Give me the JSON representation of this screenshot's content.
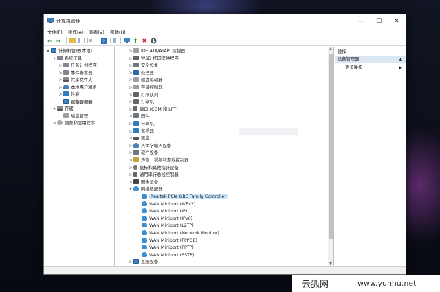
{
  "window": {
    "title": "计算机管理"
  },
  "menu": [
    "文件(F)",
    "操作(A)",
    "查看(V)",
    "帮助(H)"
  ],
  "toolbar_icons": [
    "back-arrow-icon",
    "forward-arrow-icon",
    "folder-up-icon",
    "console-tree-icon",
    "properties-icon",
    "help-icon",
    "view-icon",
    "monitor-icon",
    "enable-device-icon",
    "uninstall-device-icon",
    "update-driver-icon"
  ],
  "tree": [
    {
      "label": "计算机管理(本地)",
      "exp": "▾",
      "indent": 0,
      "icon": "pc"
    },
    {
      "label": "系统工具",
      "exp": "▾",
      "indent": 1,
      "icon": "tool"
    },
    {
      "label": "任务计划程序",
      "exp": ">",
      "indent": 2,
      "icon": "tool"
    },
    {
      "label": "事件查看器",
      "exp": ">",
      "indent": 2,
      "icon": "tool"
    },
    {
      "label": "共享文件夹",
      "exp": ">",
      "indent": 2,
      "icon": "store"
    },
    {
      "label": "本地用户和组",
      "exp": ">",
      "indent": 2,
      "icon": "person"
    },
    {
      "label": "性能",
      "exp": ">",
      "indent": 2,
      "icon": "mon"
    },
    {
      "label": "设备管理器",
      "exp": "",
      "indent": 2,
      "icon": "pc",
      "selected": true
    },
    {
      "label": "存储",
      "exp": "▾",
      "indent": 1,
      "icon": "store"
    },
    {
      "label": "磁盘管理",
      "exp": "",
      "indent": 2,
      "icon": "disk"
    },
    {
      "label": "服务和应用程序",
      "exp": ">",
      "indent": 1,
      "icon": "gear"
    }
  ],
  "devices": [
    {
      "label": "IDE ATA/ATAPI 控制器",
      "exp": ">",
      "icon": "disk"
    },
    {
      "label": "WSD 打印提供程序",
      "exp": ">",
      "icon": "printer"
    },
    {
      "label": "安全设备",
      "exp": ">",
      "icon": "dev"
    },
    {
      "label": "处理器",
      "exp": ">",
      "icon": "cpu"
    },
    {
      "label": "磁盘驱动器",
      "exp": ">",
      "icon": "disk"
    },
    {
      "label": "存储控制器",
      "exp": ">",
      "icon": "disk"
    },
    {
      "label": "打印队列",
      "exp": ">",
      "icon": "printer"
    },
    {
      "label": "打印机",
      "exp": ">",
      "icon": "printer"
    },
    {
      "label": "端口 (COM 和 LPT)",
      "exp": ">",
      "icon": "usb"
    },
    {
      "label": "固件",
      "exp": ">",
      "icon": "dev"
    },
    {
      "label": "计算机",
      "exp": ">",
      "icon": "mon"
    },
    {
      "label": "监视器",
      "exp": ">",
      "icon": "mon"
    },
    {
      "label": "键盘",
      "exp": ">",
      "icon": "keyb"
    },
    {
      "label": "人体学输入设备",
      "exp": ">",
      "icon": "person"
    },
    {
      "label": "软件设备",
      "exp": ">",
      "icon": "dev"
    },
    {
      "label": "声音、视频和游戏控制器",
      "exp": ">",
      "icon": "sound"
    },
    {
      "label": "鼠标和其他指针设备",
      "exp": ">",
      "icon": "mouse"
    },
    {
      "label": "通用串行总线控制器",
      "exp": ">",
      "icon": "usb"
    },
    {
      "label": "图像设备",
      "exp": ">",
      "icon": "cam"
    },
    {
      "label": "网络适配器",
      "exp": "▾",
      "icon": "net"
    },
    {
      "label": "Realtek PCIe GBE Family Controller",
      "exp": "",
      "icon": "net",
      "child": true,
      "selected": true
    },
    {
      "label": "WAN Miniport (IKEv2)",
      "exp": "",
      "icon": "net",
      "child": true
    },
    {
      "label": "WAN Miniport (IP)",
      "exp": "",
      "icon": "net",
      "child": true
    },
    {
      "label": "WAN Miniport (IPv6)",
      "exp": "",
      "icon": "net",
      "child": true
    },
    {
      "label": "WAN Miniport (L2TP)",
      "exp": "",
      "icon": "net",
      "child": true
    },
    {
      "label": "WAN Miniport (Network Monitor)",
      "exp": "",
      "icon": "net",
      "child": true
    },
    {
      "label": "WAN Miniport (PPPOE)",
      "exp": "",
      "icon": "net",
      "child": true
    },
    {
      "label": "WAN Miniport (PPTP)",
      "exp": "",
      "icon": "net",
      "child": true
    },
    {
      "label": "WAN Miniport (SSTP)",
      "exp": "",
      "icon": "net",
      "child": true
    },
    {
      "label": "系统设备",
      "exp": ">",
      "icon": "pc"
    }
  ],
  "actions": {
    "header": "操作",
    "section": "设备管理器",
    "more": "更多操作"
  },
  "watermark": {
    "brand": "云狐网",
    "url": "www.yunhu.net"
  }
}
